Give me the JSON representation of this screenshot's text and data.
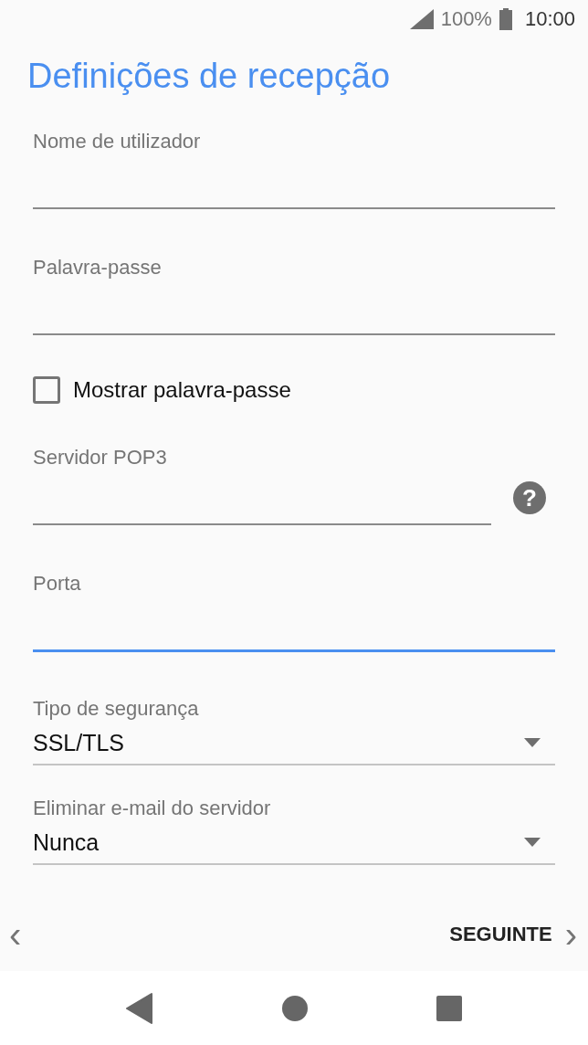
{
  "status_bar": {
    "battery": "100%",
    "time": "10:00"
  },
  "title": "Definições de recepção",
  "fields": [
    {
      "kind": "text",
      "label": "Nome de utilizador",
      "focused": false
    },
    {
      "kind": "text",
      "label": "Palavra-passe",
      "focused": false
    },
    {
      "kind": "checkbox",
      "label": "Mostrar palavra-passe",
      "checked": false
    },
    {
      "kind": "text",
      "label": "Servidor POP3",
      "focused": false,
      "help": "?"
    },
    {
      "kind": "text",
      "label": "Porta",
      "focused": true
    },
    {
      "kind": "select",
      "label": "Tipo de segurança",
      "value": "SSL/TLS"
    },
    {
      "kind": "select",
      "label": "Eliminar e-mail do servidor",
      "value": "Nunca"
    }
  ],
  "footer": {
    "back": "‹",
    "next": "SEGUINTE",
    "next_arrow": "›"
  }
}
